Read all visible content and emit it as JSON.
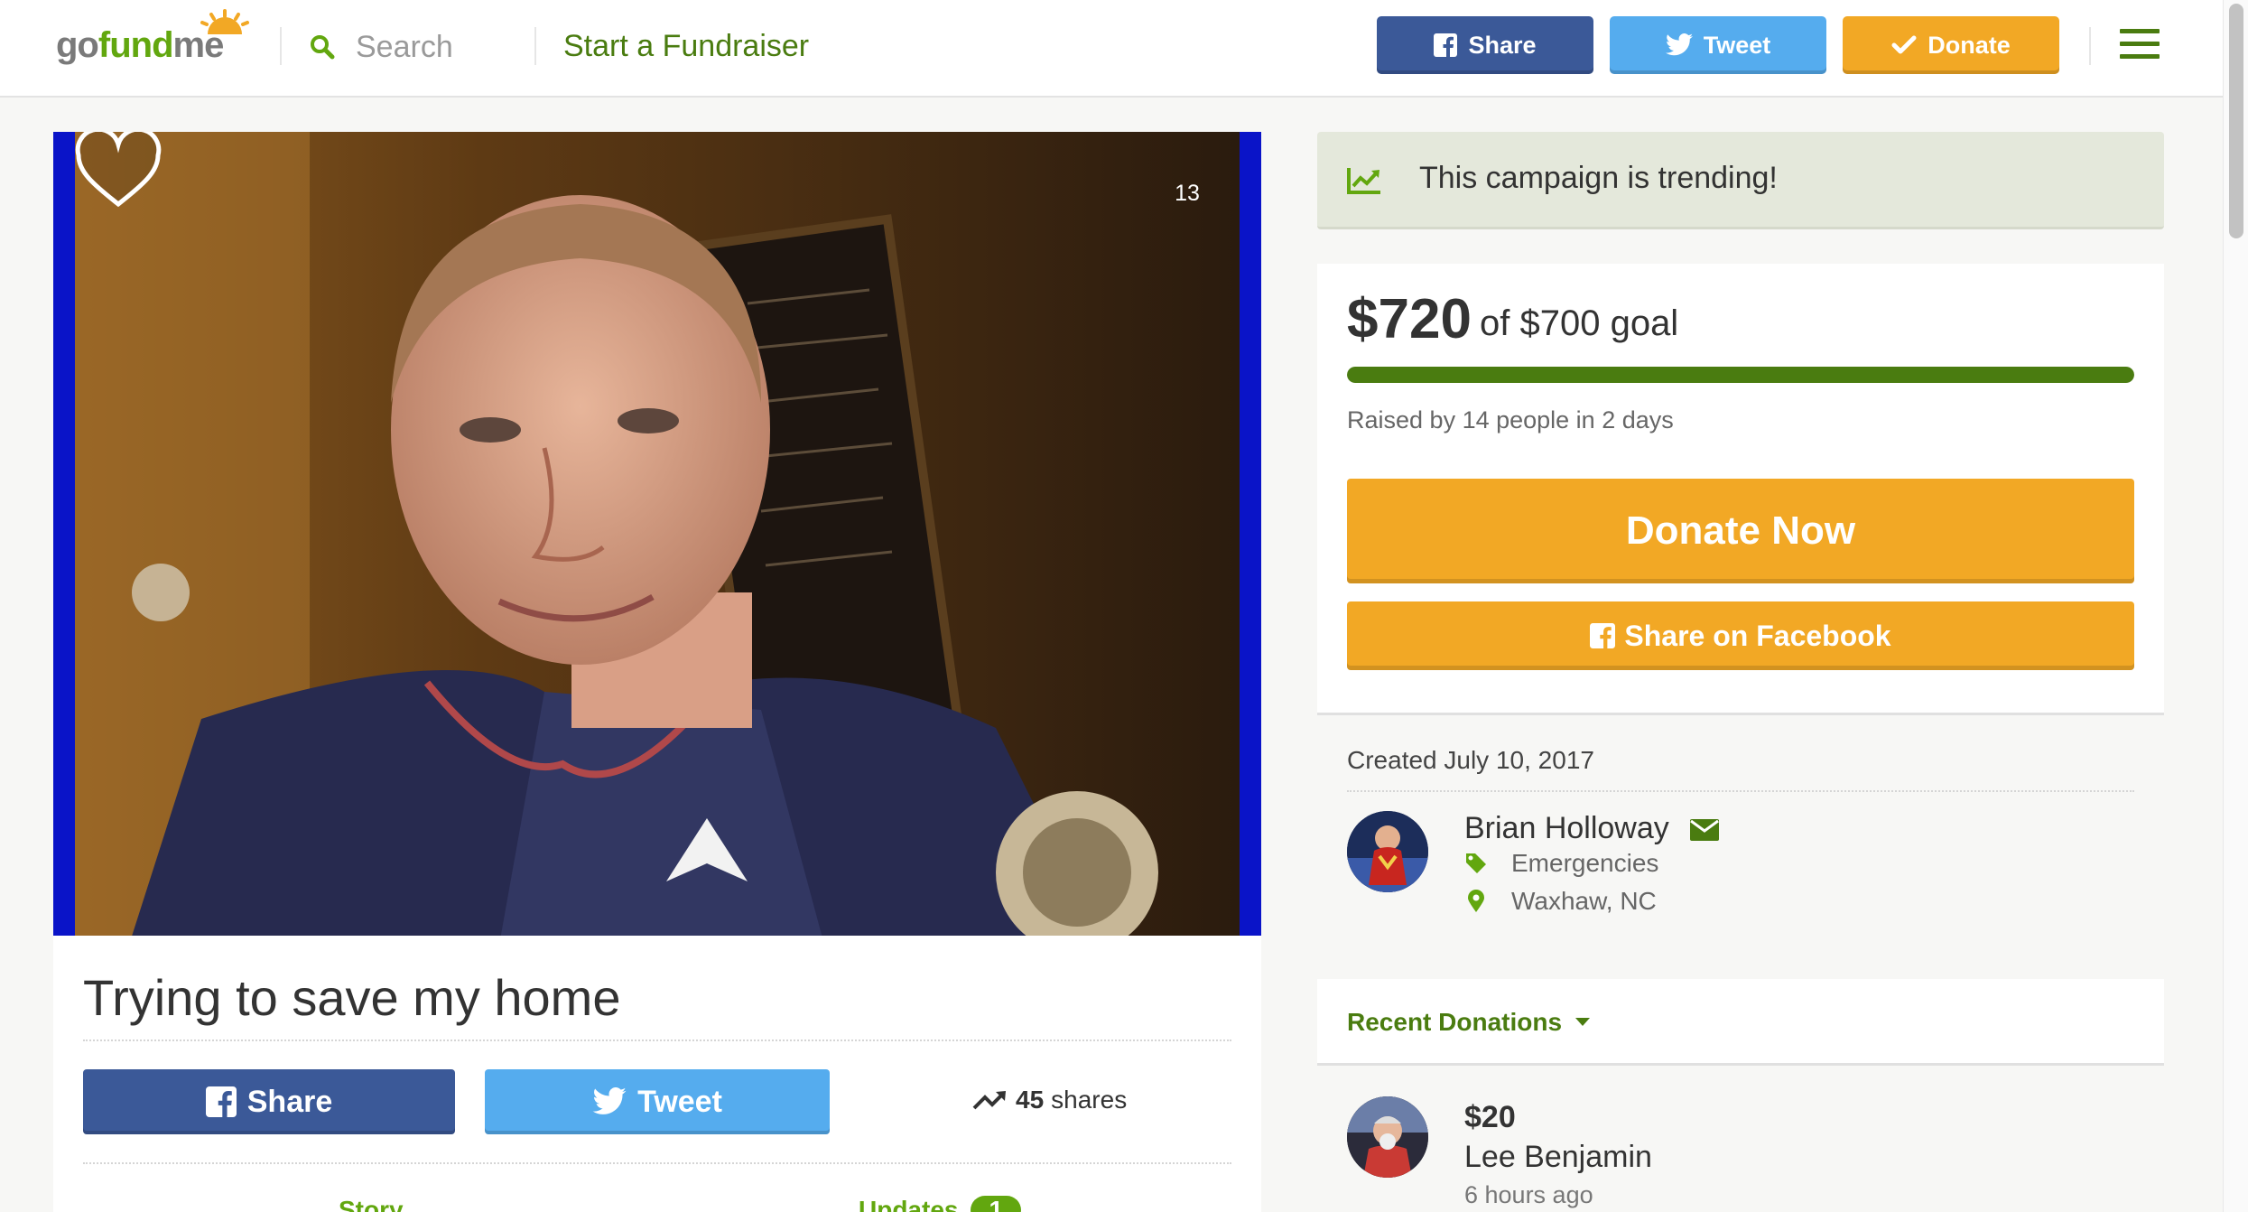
{
  "header": {
    "logo_go": "go",
    "logo_fund": "fund",
    "logo_me": "me",
    "search_placeholder": "Search",
    "start_fundraiser": "Start a Fundraiser",
    "share_label": "Share",
    "tweet_label": "Tweet",
    "donate_label": "Donate"
  },
  "campaign": {
    "heart_count": "13",
    "title": "Trying to save my home",
    "share_label": "Share",
    "tweet_label": "Tweet",
    "shares_count": "45",
    "shares_suffix": "shares",
    "tabs": [
      {
        "label": "Story"
      },
      {
        "label": "Updates",
        "badge": "1"
      }
    ]
  },
  "sidebar": {
    "trending_text": "This campaign is trending!",
    "raised_amount": "$720",
    "goal_text": "of $700 goal",
    "progress_fraction": 1.0,
    "raised_by": "Raised by 14 people in 2 days",
    "donate_now": "Donate Now",
    "share_facebook": "Share on Facebook",
    "created": "Created July 10, 2017",
    "organizer_name": "Brian Holloway",
    "category": "Emergencies",
    "location": "Waxhaw, NC",
    "recent_donations_label": "Recent Donations",
    "donations": [
      {
        "amount": "$20",
        "name": "Lee Benjamin",
        "time": "6 hours ago"
      }
    ]
  },
  "colors": {
    "brand_green": "#62a70f",
    "dark_green": "#4a7c10",
    "facebook_blue": "#3b5998",
    "twitter_blue": "#55acee",
    "donate_orange": "#f2a825"
  },
  "icons": [
    "sun-logo-icon",
    "search-icon",
    "facebook-icon",
    "twitter-icon",
    "check-icon",
    "menu-icon",
    "heart-icon",
    "trending-icon",
    "mail-icon",
    "tag-icon",
    "location-pin-icon",
    "caret-down-icon"
  ]
}
